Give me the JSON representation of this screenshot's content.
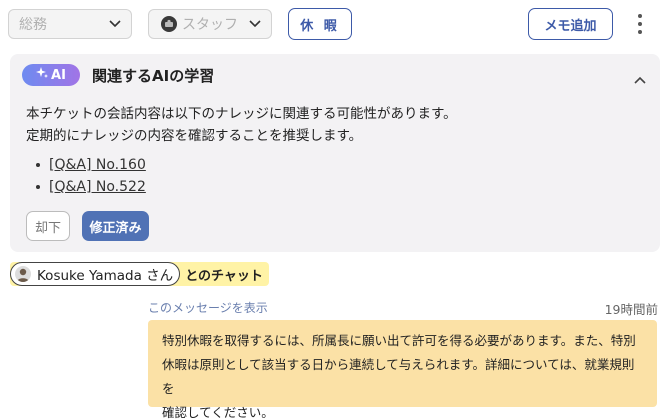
{
  "toolbar": {
    "department_select": "総務",
    "staff_select": "スタッフ",
    "leave_button": "休 暇",
    "memo_button": "メモ追加"
  },
  "ai_card": {
    "badge": "AI",
    "title": "関連するAIの学習",
    "body_line1": "本チケットの会話内容は以下のナレッジに関連する可能性があります。",
    "body_line2": "定期的にナレッジの内容を確認することを推奨します。",
    "links": [
      "[Q&A] No.160",
      "[Q&A] No.522"
    ],
    "reject_button": "却下",
    "fixed_button": "修正済み"
  },
  "chat": {
    "user_name": "Kosuke Yamada さん",
    "with_label": "とのチャット",
    "show_message_link": "このメッセージを表示",
    "timestamp": "19時間前",
    "message_line1": "特別休暇を取得するには、所属長に願い出て許可を得る必要があります。また、特別",
    "message_line2": "休暇は原則として該当する日から連続して与えられます。詳細については、就業規則を",
    "message_line3": "確認してください。"
  },
  "colors": {
    "accent_blue": "#3d5aa8",
    "fixed_button_bg": "#5072b5",
    "highlight_yellow": "#fff3a6",
    "bubble_bg": "#fbe1a6",
    "card_bg": "#f3f2f4"
  },
  "icons": [
    "chevron-down-icon",
    "staff-avatar-icon",
    "kebab-menu-icon",
    "sparkle-icon",
    "chevron-up-icon",
    "user-avatar-icon"
  ]
}
